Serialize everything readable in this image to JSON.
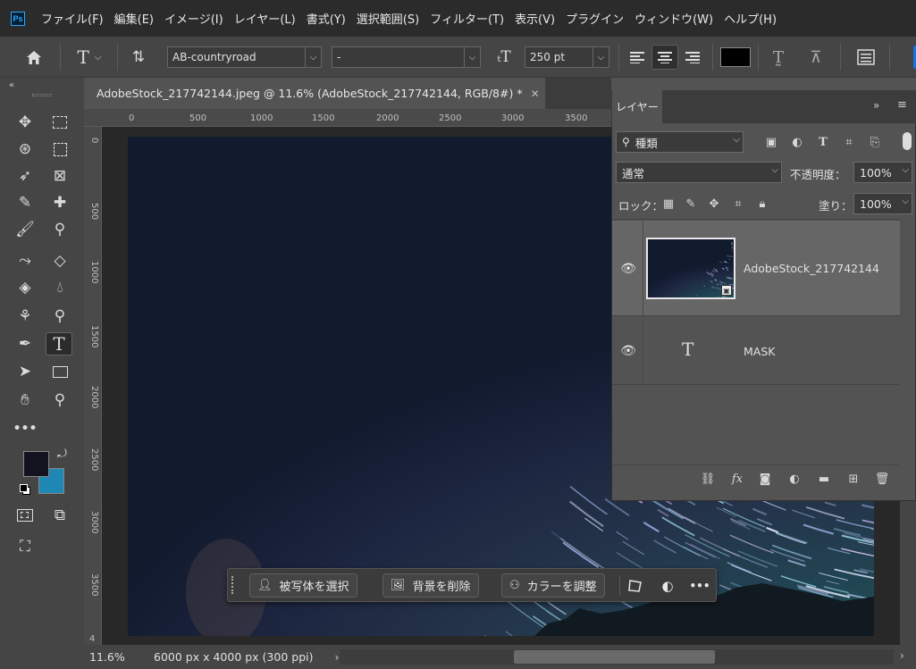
{
  "app": {
    "logo_text": "Ps"
  },
  "menu": [
    "ファイル(F)",
    "編集(E)",
    "イメージ(I)",
    "レイヤー(L)",
    "書式(Y)",
    "選択範囲(S)",
    "フィルター(T)",
    "表示(V)",
    "プラグイン",
    "ウィンドウ(W)",
    "ヘルプ(H)"
  ],
  "options": {
    "font_family": "AB-countryroad",
    "font_style": "-",
    "font_size": "250 pt",
    "text_color": "#000000"
  },
  "document": {
    "tab_title": "AdobeStock_217742144.jpeg @ 11.6% (AdobeStock_217742144, RGB/8#) *",
    "zoom": "11.6%",
    "dimensions": "6000 px x 4000 px (300 ppi)",
    "ruler_top": [
      "0",
      "500",
      "1000",
      "1500",
      "2000",
      "2500",
      "3000",
      "3500"
    ],
    "ruler_left": [
      "0",
      "500",
      "1000",
      "1500",
      "2000",
      "2500",
      "3000",
      "3500",
      "4"
    ]
  },
  "taskbar": {
    "select_subject": "被写体を選択",
    "remove_background": "背景を削除",
    "adjust_color": "カラーを調整",
    "more": "•••"
  },
  "tools": {
    "foreground_color": "#13131f",
    "background_color": "#1e87b4"
  },
  "layers_panel": {
    "tab_label": "レイヤー",
    "filter_kind": "種類",
    "blend_mode": "通常",
    "opacity_label": "不透明度：",
    "opacity_value": "100%",
    "lock_label": "ロック：",
    "fill_label": "塗り：",
    "fill_value": "100%",
    "layers": [
      {
        "name": "AdobeStock_217742144",
        "type": "smart-object",
        "visible": true
      },
      {
        "name": "MASK",
        "type": "text",
        "visible": true
      }
    ]
  }
}
